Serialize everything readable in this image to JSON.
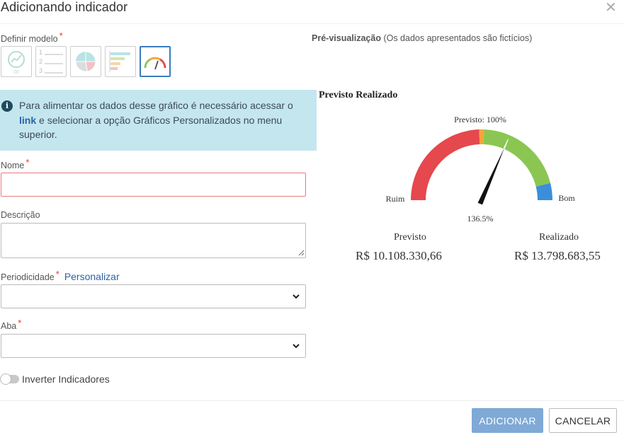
{
  "dialog": {
    "title": "Adicionando indicador",
    "close_symbol": "✕"
  },
  "form": {
    "model_label": "Definir modelo",
    "required_mark": "*",
    "models": [
      {
        "icon": "line-chart-icon",
        "selected": false
      },
      {
        "icon": "numbered-list-icon",
        "selected": false
      },
      {
        "icon": "pie-chart-icon",
        "selected": false
      },
      {
        "icon": "horizontal-bar-icon",
        "selected": false
      },
      {
        "icon": "gauge-icon",
        "selected": true
      }
    ],
    "info": {
      "text_before": "Para alimentar os dados desse gráfico é necessário acessar o ",
      "link": "link",
      "text_after": " e selecionar a opção Gráficos Personalizados no menu superior."
    },
    "name_label": "Nome",
    "name_value": "",
    "description_label": "Descrição",
    "description_value": "",
    "periodicity_label": "Periodicidade",
    "personalize_link": "Personalizar",
    "periodicity_value": "",
    "tab_label": "Aba",
    "tab_value": "",
    "invert_label": "Inverter Indicadores",
    "invert_on": false
  },
  "preview": {
    "label_bold": "Pré-visualização",
    "label_rest": " (Os dados apresentados são fictícios)"
  },
  "chart_data": {
    "type": "gauge",
    "title": "Previsto Realizado",
    "target_label": "Previsto: 100%",
    "value_label": "136.5%",
    "value_percent": 136.5,
    "bands": [
      {
        "name": "Ruim",
        "color": "#e5484d"
      },
      {
        "name": "Previsto",
        "color": "#f4a53a"
      },
      {
        "name": "",
        "color": "#8bc653"
      },
      {
        "name": "Bom",
        "color": "#3b8fd9"
      }
    ],
    "left_label": "Ruim",
    "right_label": "Bom",
    "planned_label": "Previsto",
    "planned_value": "R$ 10.108.330,66",
    "actual_label": "Realizado",
    "actual_value": "R$ 13.798.683,55"
  },
  "footer": {
    "add_label": "ADICIONAR",
    "cancel_label": "CANCELAR"
  },
  "colors": {
    "accent": "#3a7cc0",
    "info_bg": "#c4e6ef",
    "add_button": "#7fa9d6",
    "required": "#e53935"
  }
}
